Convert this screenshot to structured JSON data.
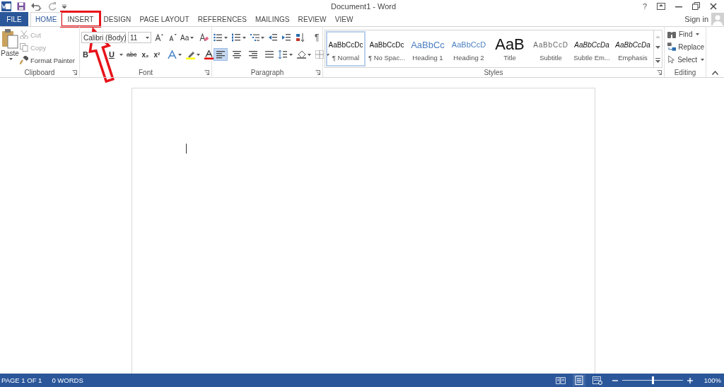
{
  "window": {
    "title": "Document1 - Word",
    "help": "?"
  },
  "tabs": [
    {
      "label": "FILE",
      "kind": "file",
      "selected": false
    },
    {
      "label": "HOME",
      "kind": "tab",
      "selected": true
    },
    {
      "label": "INSERT",
      "kind": "tab",
      "selected": false,
      "highlighted": true
    },
    {
      "label": "DESIGN",
      "kind": "tab",
      "selected": false
    },
    {
      "label": "PAGE LAYOUT",
      "kind": "tab",
      "selected": false
    },
    {
      "label": "REFERENCES",
      "kind": "tab",
      "selected": false
    },
    {
      "label": "MAILINGS",
      "kind": "tab",
      "selected": false
    },
    {
      "label": "REVIEW",
      "kind": "tab",
      "selected": false
    },
    {
      "label": "VIEW",
      "kind": "tab",
      "selected": false
    }
  ],
  "account": {
    "label": "Sign in"
  },
  "clipboard": {
    "paste": "Paste",
    "group": "Clipboard",
    "items": [
      {
        "label": "Cut",
        "kind": "cut",
        "disabled": true
      },
      {
        "label": "Copy",
        "kind": "copy",
        "disabled": true
      },
      {
        "label": "Format Painter",
        "kind": "painter",
        "disabled": false
      }
    ]
  },
  "font": {
    "name": "Calibri (Body)",
    "size": "11",
    "change_case": "Aa",
    "group": "Font",
    "format_buttons": [
      {
        "label": "B",
        "kind": "bold"
      },
      {
        "label": "U",
        "kind": "underline"
      },
      {
        "label": "abc",
        "kind": "strike"
      },
      {
        "label": "x₂",
        "kind": "sub"
      },
      {
        "label": "x²",
        "kind": "sup"
      }
    ]
  },
  "paragraph": {
    "pilcrow": "¶",
    "group": "Paragraph",
    "alignments": [
      {
        "kind": "left",
        "selected": true
      },
      {
        "kind": "center",
        "selected": false
      },
      {
        "kind": "right",
        "selected": false
      },
      {
        "kind": "justify",
        "selected": false
      }
    ]
  },
  "styles": {
    "group": "Styles",
    "items": [
      {
        "sample": "AaBbCcDc",
        "label": "¶ Normal",
        "kind": "normal",
        "selected": true
      },
      {
        "sample": "AaBbCcDc",
        "label": "¶ No Spac...",
        "kind": "normal",
        "selected": false
      },
      {
        "sample": "AaBbCc",
        "label": "Heading 1",
        "kind": "heading1",
        "selected": false
      },
      {
        "sample": "AaBbCcD",
        "label": "Heading 2",
        "kind": "heading2",
        "selected": false
      },
      {
        "sample": "AaB",
        "label": "Title",
        "kind": "title",
        "selected": false
      },
      {
        "sample": "AaBbCcD",
        "label": "Subtitle",
        "kind": "subtitle",
        "selected": false
      },
      {
        "sample": "AaBbCcDa",
        "label": "Subtle Em...",
        "kind": "italic",
        "selected": false
      },
      {
        "sample": "AaBbCcDa",
        "label": "Emphasis",
        "kind": "italic",
        "selected": false
      }
    ]
  },
  "editing": {
    "group": "Editing",
    "items": [
      {
        "label": "Find",
        "kind": "find"
      },
      {
        "label": "Replace",
        "kind": "replace"
      },
      {
        "label": "Select",
        "kind": "select"
      }
    ]
  },
  "status_bar": {
    "page": "PAGE 1 OF 1",
    "words": "0 WORDS",
    "zoom": "100%",
    "zoom_slider": {
      "level": 0.5
    }
  }
}
